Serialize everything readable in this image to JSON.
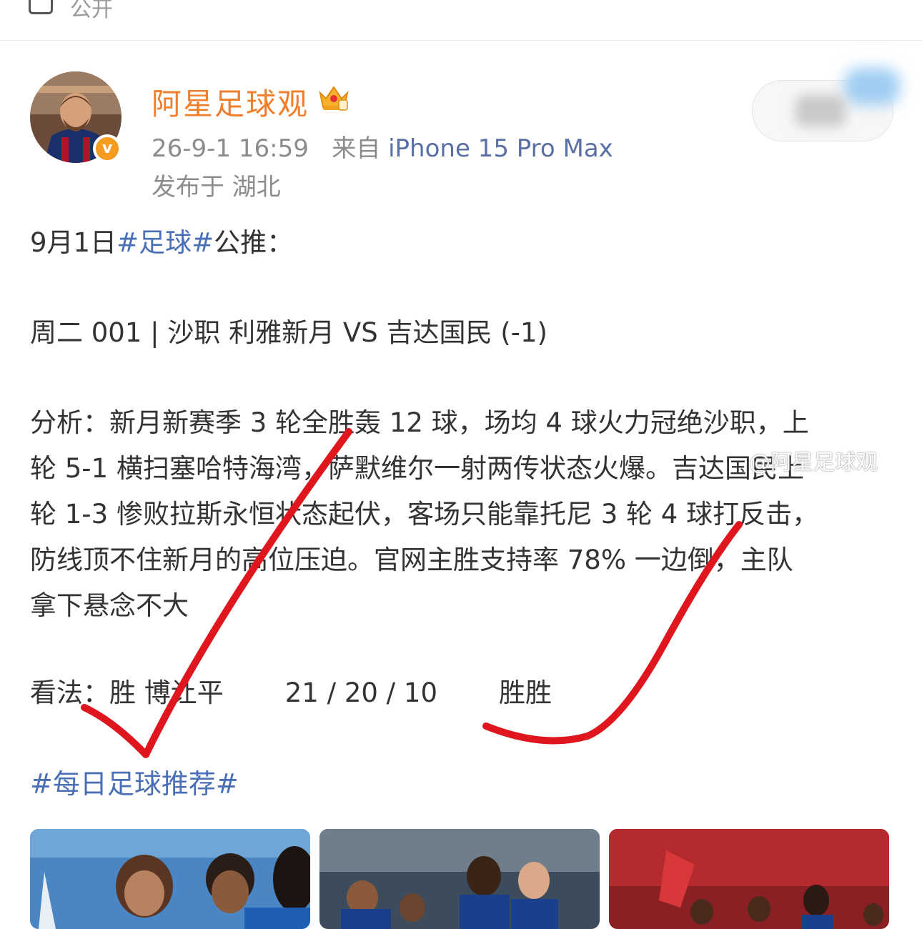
{
  "topbar": {
    "visibility_label": "公开"
  },
  "post": {
    "author": "阿星足球观",
    "time": "26-9-1 16:59",
    "from_label": "来自",
    "device": "iPhone 15 Pro Max",
    "location": "发布于 湖北",
    "lines": {
      "l1_prefix": "9月1日",
      "l1_tag": "#足球#",
      "l1_suffix": "公推：",
      "match": "周二 001 | 沙职 利雅新月 VS 吉达国民 (-1)",
      "analysis_1": "分析：新月新赛季 3 轮全胜轰 12 球，场均 4 球火力冠绝沙职，上",
      "analysis_2": "轮 5-1 横扫塞哈特海湾，萨默维尔一射两传状态火爆。吉达国民上",
      "analysis_3": "轮 1-3 惨败拉斯永恒状态起伏，客场只能靠托尼 3 轮 4 球打反击，",
      "analysis_4": "防线顶不住新月的高位压迫。官网主胜支持率 78% 一边倒，主队",
      "analysis_5": "拿下悬念不大",
      "view_label": "看法：胜 博让平",
      "view_score": "21 / 20 / 10",
      "view_result": "胜胜"
    },
    "watermark": "@阿星足球观",
    "hashtag": "#每日足球推荐#"
  },
  "colors": {
    "username": "#f17e2a",
    "link": "#4a6fb5",
    "meta": "#8c8c8c",
    "check_mark": "#e0161e"
  }
}
